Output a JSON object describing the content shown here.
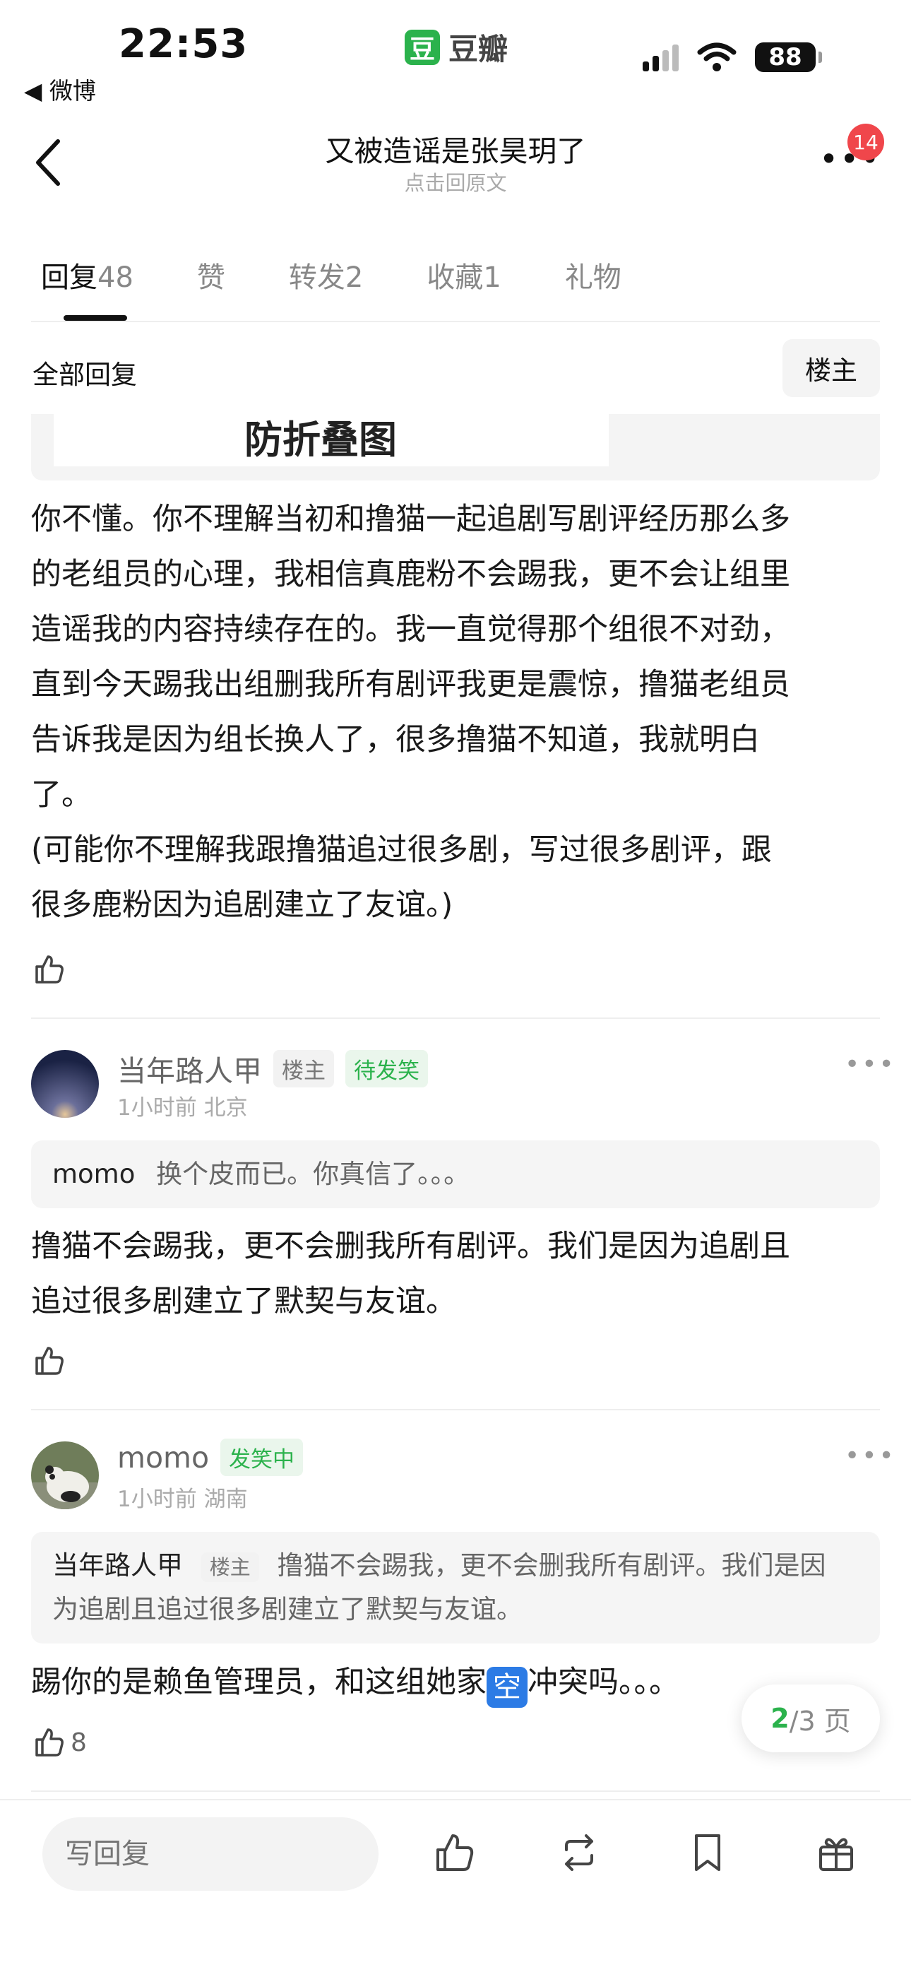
{
  "status_bar": {
    "time": "22:53",
    "back_app": "◀ 微博",
    "app_name": "豆瓣",
    "app_logo_char": "豆",
    "battery": "88"
  },
  "nav": {
    "title": "又被造谣是张昊玥了",
    "subtitle": "点击回原文",
    "more": "•••",
    "badge": "14"
  },
  "tabs": [
    {
      "label": "回复",
      "count": "48"
    },
    {
      "label": "赞",
      "count": ""
    },
    {
      "label": "转发",
      "count": "2"
    },
    {
      "label": "收藏",
      "count": "1"
    },
    {
      "label": "礼物",
      "count": ""
    }
  ],
  "filter": {
    "all_replies": "全部回复",
    "owner_only": "楼主"
  },
  "image_caption": "防折叠图",
  "post": {
    "lines": [
      "你不懂。你不理解当初和撸猫一起追剧写剧评经历那么多",
      "的老组员的心理，我相信真鹿粉不会踢我，更不会让组里",
      "造谣我的内容持续存在的。我一直觉得那个组很不对劲，",
      "直到今天踢我出组删我所有剧评我更是震惊，撸猫老组员",
      "告诉我是因为组长换人了，很多撸猫不知道，我就明白",
      "了。",
      "(可能你不理解我跟撸猫追过很多剧，写过很多剧评，跟",
      "很多鹿粉因为追剧建立了友谊。)"
    ]
  },
  "replies": [
    {
      "username": "当年路人甲",
      "tags": [
        "楼主",
        "待发笑"
      ],
      "meta": "1小时前 北京",
      "quote_user": "momo",
      "quote_tag": "",
      "quote_text": "换个皮而已。你真信了。。。",
      "lines": [
        "撸猫不会踢我，更不会删我所有剧评。我们是因为追剧且",
        "追过很多剧建立了默契与友谊。"
      ],
      "likes": ""
    },
    {
      "username": "momo",
      "tags": [
        "发笑中"
      ],
      "meta": "1小时前 湖南",
      "quote_user": "当年路人甲",
      "quote_tag": "楼主",
      "quote_line1": "撸猫不会踢我，更不会删我所有剧评。我们是因",
      "quote_line2": "为追剧且追过很多剧建立了默契与友谊。",
      "text_before": "踢你的是赖鱼管理员，和这组她家",
      "emoji": "空",
      "text_after": "冲突吗。。。",
      "likes": "8"
    }
  ],
  "pager": {
    "current": "2",
    "total": "/3 页"
  },
  "bottom": {
    "reply_placeholder": "写回复"
  },
  "colors": {
    "accent": "#2bb24c",
    "badge": "#f0464b"
  }
}
